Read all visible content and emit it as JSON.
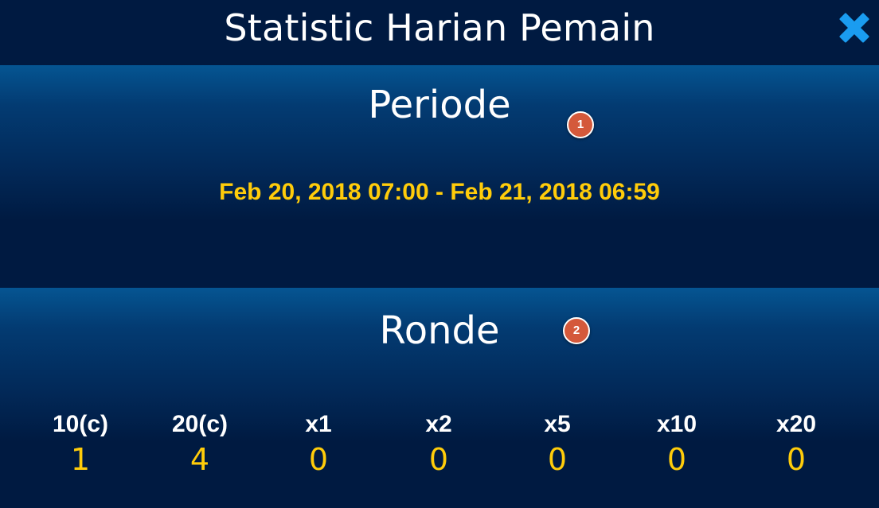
{
  "header": {
    "title": "Statistic Harian Pemain",
    "close_icon": "close-icon",
    "close_color": "#1a9cf0"
  },
  "periode": {
    "title": "Periode",
    "badge": "1",
    "value": "Feb 20, 2018 07:00 - Feb 21, 2018 06:59"
  },
  "ronde": {
    "title": "Ronde",
    "badge": "2",
    "stats": [
      {
        "label": "10(c)",
        "value": "1"
      },
      {
        "label": "20(c)",
        "value": "4"
      },
      {
        "label": "x1",
        "value": "0"
      },
      {
        "label": "x2",
        "value": "0"
      },
      {
        "label": "x5",
        "value": "0"
      },
      {
        "label": "x10",
        "value": "0"
      },
      {
        "label": "x20",
        "value": "0"
      }
    ]
  },
  "colors": {
    "background": "#001a41",
    "accent_yellow": "#ffcc0a",
    "badge": "#d4593b"
  }
}
